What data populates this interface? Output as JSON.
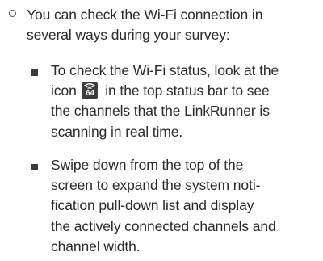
{
  "intro": {
    "lines": [
      "You can check the Wi-Fi connection in",
      "several ways during your survey:"
    ]
  },
  "item1": {
    "lines": [
      "To check the Wi-Fi status, look at the",
      "icon",
      "in the top status bar to see",
      "the channels that the LinkRunner is",
      "scanning in real time."
    ],
    "icon": {
      "name": "wifi-channel-status-icon",
      "number": "64",
      "background": "#3c3c3c"
    }
  },
  "item2": {
    "lines": [
      "Swipe down from the top of the",
      "screen to expand the system noti-",
      "fication pull-down list and display",
      "the actively connected channels and",
      "channel width."
    ]
  }
}
